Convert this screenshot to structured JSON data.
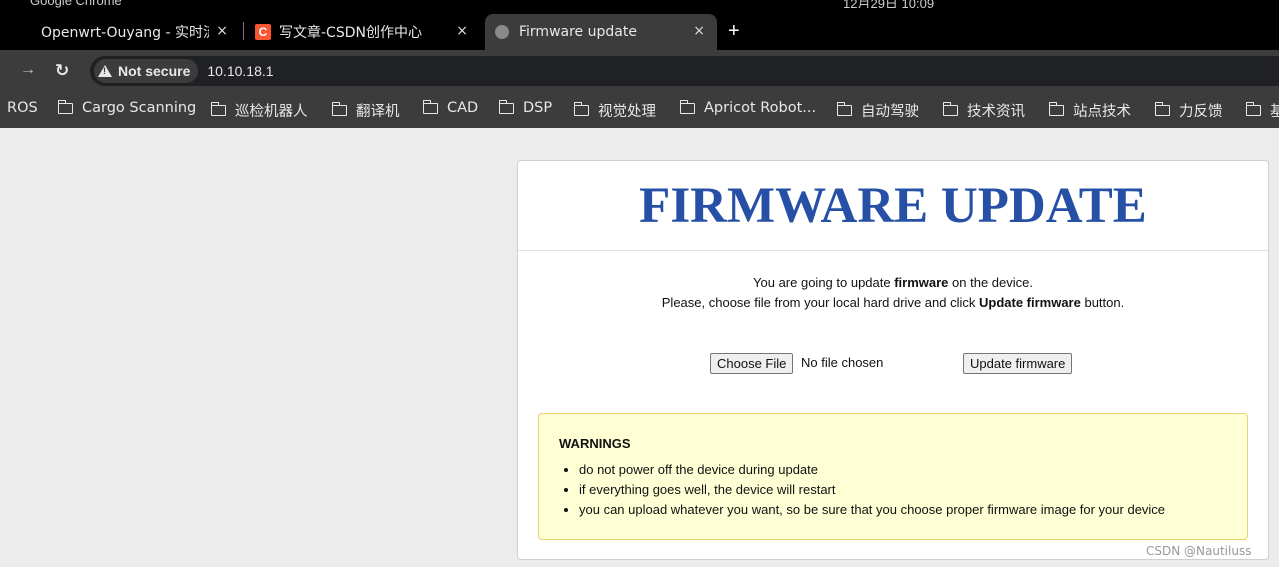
{
  "os": {
    "app_name": "Google Chrome",
    "clock": "12月29日 10:09"
  },
  "tabs": [
    {
      "title": "Openwrt-Ouyang - 实时流",
      "close": "×"
    },
    {
      "title": "写文章-CSDN创作中心",
      "favicon_letter": "C",
      "close": "×"
    },
    {
      "title": "Firmware update",
      "close": "×",
      "active": true
    }
  ],
  "new_tab": "+",
  "toolbar": {
    "forward": "→",
    "reload": "↻",
    "security_label": "Not secure",
    "url": "10.10.18.1"
  },
  "bookmarks": [
    {
      "label": "ROS",
      "folder": false
    },
    {
      "label": "Cargo Scanning",
      "folder": true
    },
    {
      "label": "巡检机器人",
      "folder": true
    },
    {
      "label": "翻译机",
      "folder": true
    },
    {
      "label": "CAD",
      "folder": true
    },
    {
      "label": "DSP",
      "folder": true
    },
    {
      "label": "视觉处理",
      "folder": true
    },
    {
      "label": "Apricot Robot...",
      "folder": true
    },
    {
      "label": "自动驾驶",
      "folder": true
    },
    {
      "label": "技术资讯",
      "folder": true
    },
    {
      "label": "站点技术",
      "folder": true
    },
    {
      "label": "力反馈",
      "folder": true
    },
    {
      "label": "基",
      "folder": true
    }
  ],
  "page": {
    "title": "FIRMWARE UPDATE",
    "intro_line1": {
      "pre": "You are going to update ",
      "bold": "firmware",
      "post": " on the device."
    },
    "intro_line2": {
      "pre": "Please, choose file from your local hard drive and click ",
      "bold": "Update firmware",
      "post": " button."
    },
    "choose_file_label": "Choose File",
    "no_file_text": "No file chosen",
    "update_button_label": "Update firmware",
    "warnings": {
      "title": "WARNINGS",
      "items": [
        "do not power off the device during update",
        "if everything goes well, the device will restart",
        "you can upload whatever you want, so be sure that you choose proper firmware image for your device"
      ]
    }
  },
  "watermark": "CSDN @Nautiluss",
  "colors": {
    "title": "#2650a6",
    "warning_bg": "#ffffd5",
    "csdn_brand": "#fc5531"
  }
}
